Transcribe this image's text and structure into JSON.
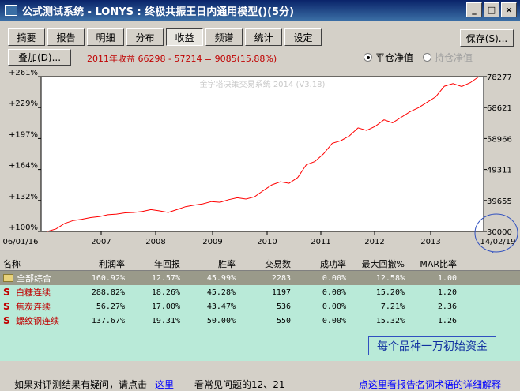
{
  "window": {
    "title": "公式测试系统 - LONYS : 终极共振王日内通用模型()(5分)",
    "buttons": {
      "minimize": "_",
      "maximize": "□",
      "close": "×"
    }
  },
  "tabs": [
    "摘要",
    "报告",
    "明细",
    "分布",
    "收益",
    "频谱",
    "统计",
    "设定"
  ],
  "active_tab": "收益",
  "toolbar": {
    "save_label": "保存(S)...",
    "overlay_label": "叠加(D)...",
    "summary_text": "2011年收益 66298 - 57214 = 9085(15.88%)",
    "radio_close": "平仓净值",
    "radio_hold": "持仓净值"
  },
  "chart_data": {
    "type": "line",
    "watermark": "金字塔决策交易系统 2014 (V3.18)",
    "left_ticks": [
      "+261%",
      "+229%",
      "+197%",
      "+164%",
      "+132%",
      "+100%"
    ],
    "right_ticks": [
      "78277",
      "68621",
      "58966",
      "49311",
      "39655",
      "30000"
    ],
    "x_ticks": [
      "06/01/16",
      "2007",
      "2008",
      "2009",
      "2010",
      "2011",
      "2012",
      "2013",
      "14/02/19"
    ],
    "ylim": [
      30000,
      78277
    ],
    "x": [
      0,
      0.02,
      0.04,
      0.06,
      0.08,
      0.1,
      0.12,
      0.14,
      0.16,
      0.18,
      0.2,
      0.22,
      0.24,
      0.26,
      0.28,
      0.3,
      0.32,
      0.34,
      0.36,
      0.38,
      0.4,
      0.42,
      0.44,
      0.46,
      0.48,
      0.5,
      0.52,
      0.54,
      0.56,
      0.58,
      0.6,
      0.62,
      0.64,
      0.66,
      0.68,
      0.7,
      0.72,
      0.74,
      0.76,
      0.78,
      0.8,
      0.82,
      0.84,
      0.86,
      0.88,
      0.9,
      0.92,
      0.94,
      0.96,
      0.98,
      1.0
    ],
    "values": [
      30000,
      30800,
      32500,
      33400,
      33800,
      34300,
      34600,
      35200,
      35400,
      35800,
      35900,
      36200,
      36800,
      36400,
      35900,
      36800,
      37700,
      38200,
      38600,
      39300,
      39100,
      39900,
      40500,
      40100,
      40800,
      42700,
      44500,
      45500,
      45000,
      46800,
      50800,
      51800,
      54200,
      57500,
      58300,
      59800,
      62300,
      61500,
      62800,
      64800,
      63900,
      65600,
      67300,
      68600,
      70300,
      72000,
      75300,
      76100,
      75200,
      76400,
      78277
    ]
  },
  "callout": "每个品种一万初始资金",
  "table": {
    "headers": [
      "名称",
      "利润率",
      "年回报",
      "胜率",
      "交易数",
      "成功率",
      "最大回撤%",
      "MAR比率"
    ],
    "rows": [
      {
        "name": "全部综合",
        "kind": "total",
        "cells": [
          "160.92%",
          "12.57%",
          "45.99%",
          "2283",
          "0.00%",
          "12.58%",
          "1.00"
        ]
      },
      {
        "name": "白糖连续",
        "kind": "item",
        "cells": [
          "288.82%",
          "18.26%",
          "45.28%",
          "1197",
          "0.00%",
          "15.20%",
          "1.20"
        ]
      },
      {
        "name": "焦炭连续",
        "kind": "item",
        "cells": [
          "56.27%",
          "17.00%",
          "43.47%",
          "536",
          "0.00%",
          "7.21%",
          "2.36"
        ]
      },
      {
        "name": "螺纹钢连续",
        "kind": "item",
        "cells": [
          "137.67%",
          "19.31%",
          "50.00%",
          "550",
          "0.00%",
          "15.32%",
          "1.26"
        ]
      }
    ]
  },
  "footer": {
    "question": "如果对评测结果有疑问，请点击",
    "here": "这里",
    "faq": "看常见问题的12、21",
    "detail_link": "点这里看报告名词术语的详细解释"
  },
  "colors": {
    "line": "#ff0000",
    "summary_text": "#c00000",
    "total_row": "#9a9a8a",
    "table_bg": "#b9ead8"
  }
}
